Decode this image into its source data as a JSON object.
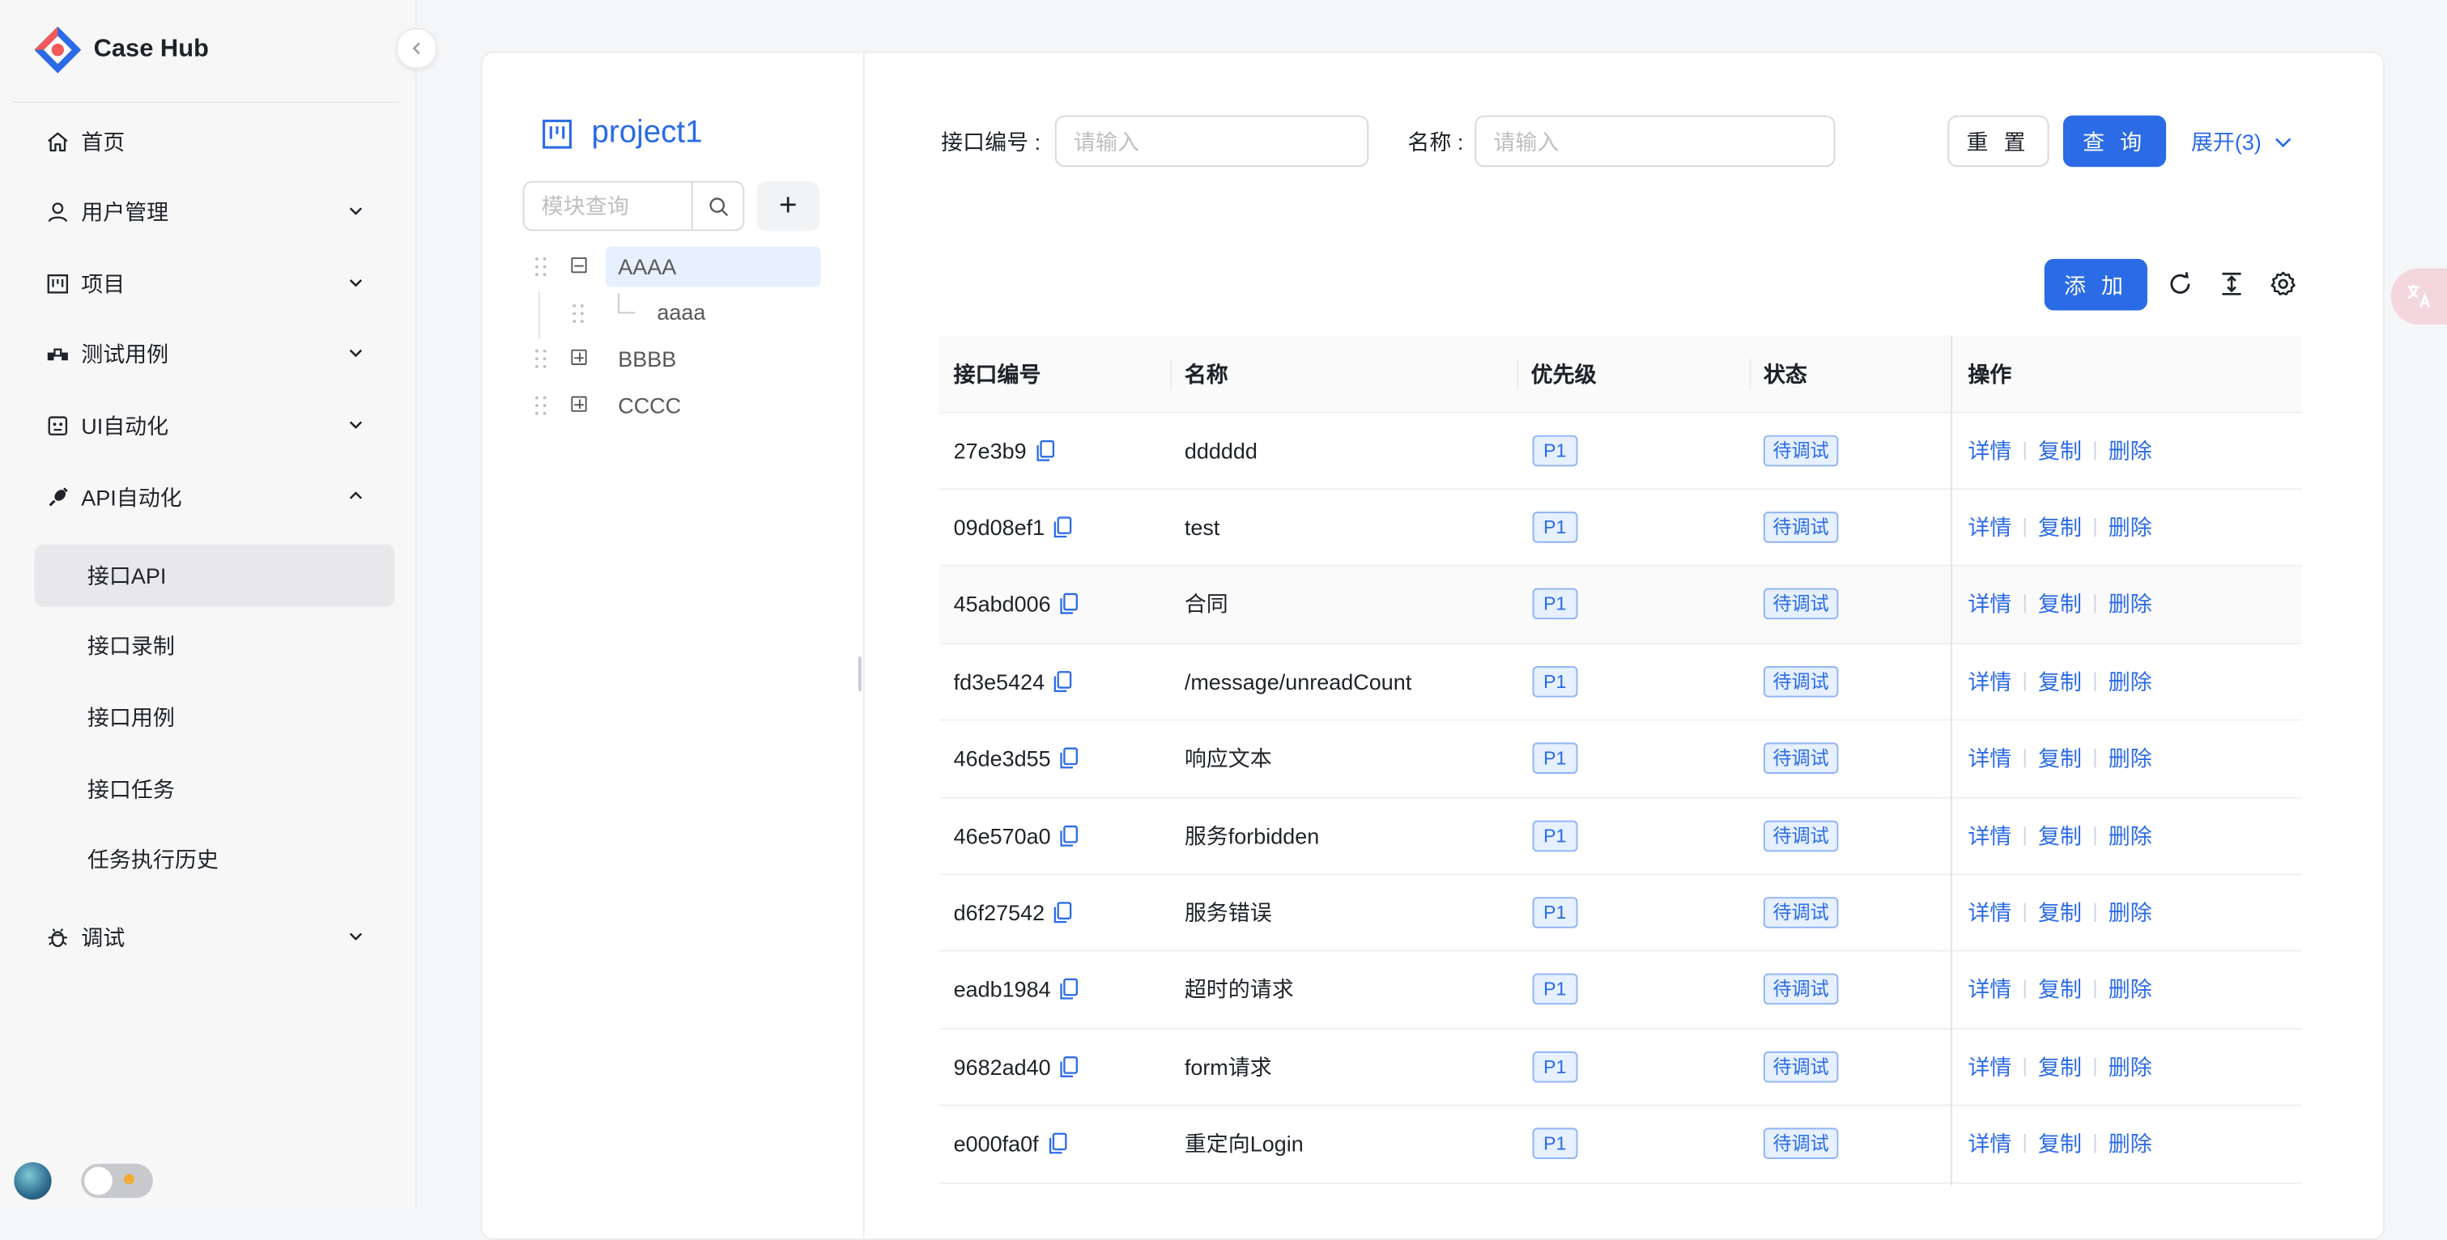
{
  "app": {
    "name": "Case Hub"
  },
  "sidebar": {
    "menus": [
      {
        "label": "首页",
        "icon": "home-icon",
        "expandable": false
      },
      {
        "label": "用户管理",
        "icon": "user-icon",
        "expandable": true
      },
      {
        "label": "项目",
        "icon": "project-icon",
        "expandable": true
      },
      {
        "label": "测试用例",
        "icon": "testcase-icon",
        "expandable": true
      },
      {
        "label": "UI自动化",
        "icon": "robot-icon",
        "expandable": true
      },
      {
        "label": "API自动化",
        "icon": "api-icon",
        "expandable": true,
        "open": true
      },
      {
        "label": "调试",
        "icon": "bug-icon",
        "expandable": true
      }
    ],
    "api_sub": [
      {
        "label": "接口API",
        "active": true
      },
      {
        "label": "接口录制"
      },
      {
        "label": "接口用例"
      },
      {
        "label": "接口任务"
      },
      {
        "label": "任务执行历史"
      }
    ]
  },
  "tree": {
    "project_name": "project1",
    "search_placeholder": "模块查询",
    "add_label": "+",
    "nodes": [
      {
        "label": "AAAA",
        "state": "expanded",
        "selected": true
      },
      {
        "label": "aaaa",
        "state": "leaf"
      },
      {
        "label": "BBBB",
        "state": "collapsed"
      },
      {
        "label": "CCCC",
        "state": "collapsed"
      }
    ]
  },
  "filters": {
    "id_label": "接口编号 :",
    "id_placeholder": "请输入",
    "name_label": "名称 :",
    "name_placeholder": "请输入",
    "reset": "重 置",
    "query": "查 询",
    "expand": "展开(3)"
  },
  "toolbar": {
    "add": "添 加",
    "icons": [
      "refresh-icon",
      "column-height-icon",
      "settings-icon"
    ]
  },
  "table": {
    "columns": [
      "接口编号",
      "名称",
      "优先级",
      "状态",
      "操作"
    ],
    "actions": [
      "详情",
      "复制",
      "删除"
    ],
    "rows": [
      {
        "id": "27e3b9",
        "name": "dddddd",
        "priority": "P1",
        "status": "待调试"
      },
      {
        "id": "09d08ef1",
        "name": "test",
        "priority": "P1",
        "status": "待调试"
      },
      {
        "id": "45abd006",
        "name": "合同",
        "priority": "P1",
        "status": "待调试"
      },
      {
        "id": "fd3e5424",
        "name": "/message/unreadCount",
        "priority": "P1",
        "status": "待调试"
      },
      {
        "id": "46de3d55",
        "name": "响应文本",
        "priority": "P1",
        "status": "待调试"
      },
      {
        "id": "46e570a0",
        "name": "服务forbidden",
        "priority": "P1",
        "status": "待调试"
      },
      {
        "id": "d6f27542",
        "name": "服务错误",
        "priority": "P1",
        "status": "待调试"
      },
      {
        "id": "eadb1984",
        "name": "超时的请求",
        "priority": "P1",
        "status": "待调试"
      },
      {
        "id": "9682ad40",
        "name": "form请求",
        "priority": "P1",
        "status": "待调试"
      },
      {
        "id": "e000fa0f",
        "name": "重定向Login",
        "priority": "P1",
        "status": "待调试"
      }
    ]
  },
  "colors": {
    "primary": "#2b6be6",
    "tag_bg": "#e6f0ff",
    "sidebar_active": "#e8e8ea"
  }
}
